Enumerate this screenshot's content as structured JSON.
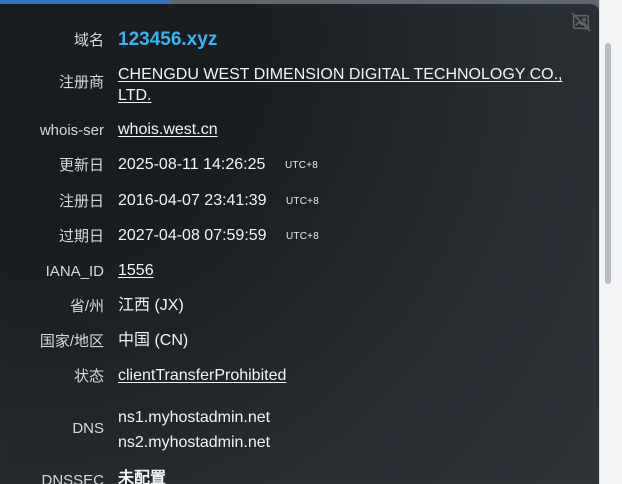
{
  "whois": {
    "labels": {
      "domain": "域名",
      "registrar": "注册商",
      "whois_server": "whois-ser",
      "updated": "更新日",
      "registered": "注册日",
      "expires": "过期日",
      "iana_id": "IANA_ID",
      "province": "省/州",
      "country": "国家/地区",
      "status": "状态",
      "dns": "DNS",
      "dnssec": "DNSSEC"
    },
    "values": {
      "domain": "123456.xyz",
      "registrar": "CHENGDU WEST DIMENSION DIGITAL TECHNOLOGY CO., LTD.",
      "whois_server": "whois.west.cn",
      "updated": "2025-08-11 14:26:25",
      "registered": "2016-04-07 23:41:39",
      "expires": "2027-04-08 07:59:59",
      "timezone": "UTC+8",
      "iana_id": "1556",
      "province": "江西 (JX)",
      "country": "中国 (CN)",
      "status": "clientTransferProhibited",
      "dns": [
        "ns1.myhostadmin.net",
        "ns2.myhostadmin.net"
      ],
      "dnssec": "未配置"
    }
  },
  "icons": {
    "image_icon": "image-icon"
  }
}
